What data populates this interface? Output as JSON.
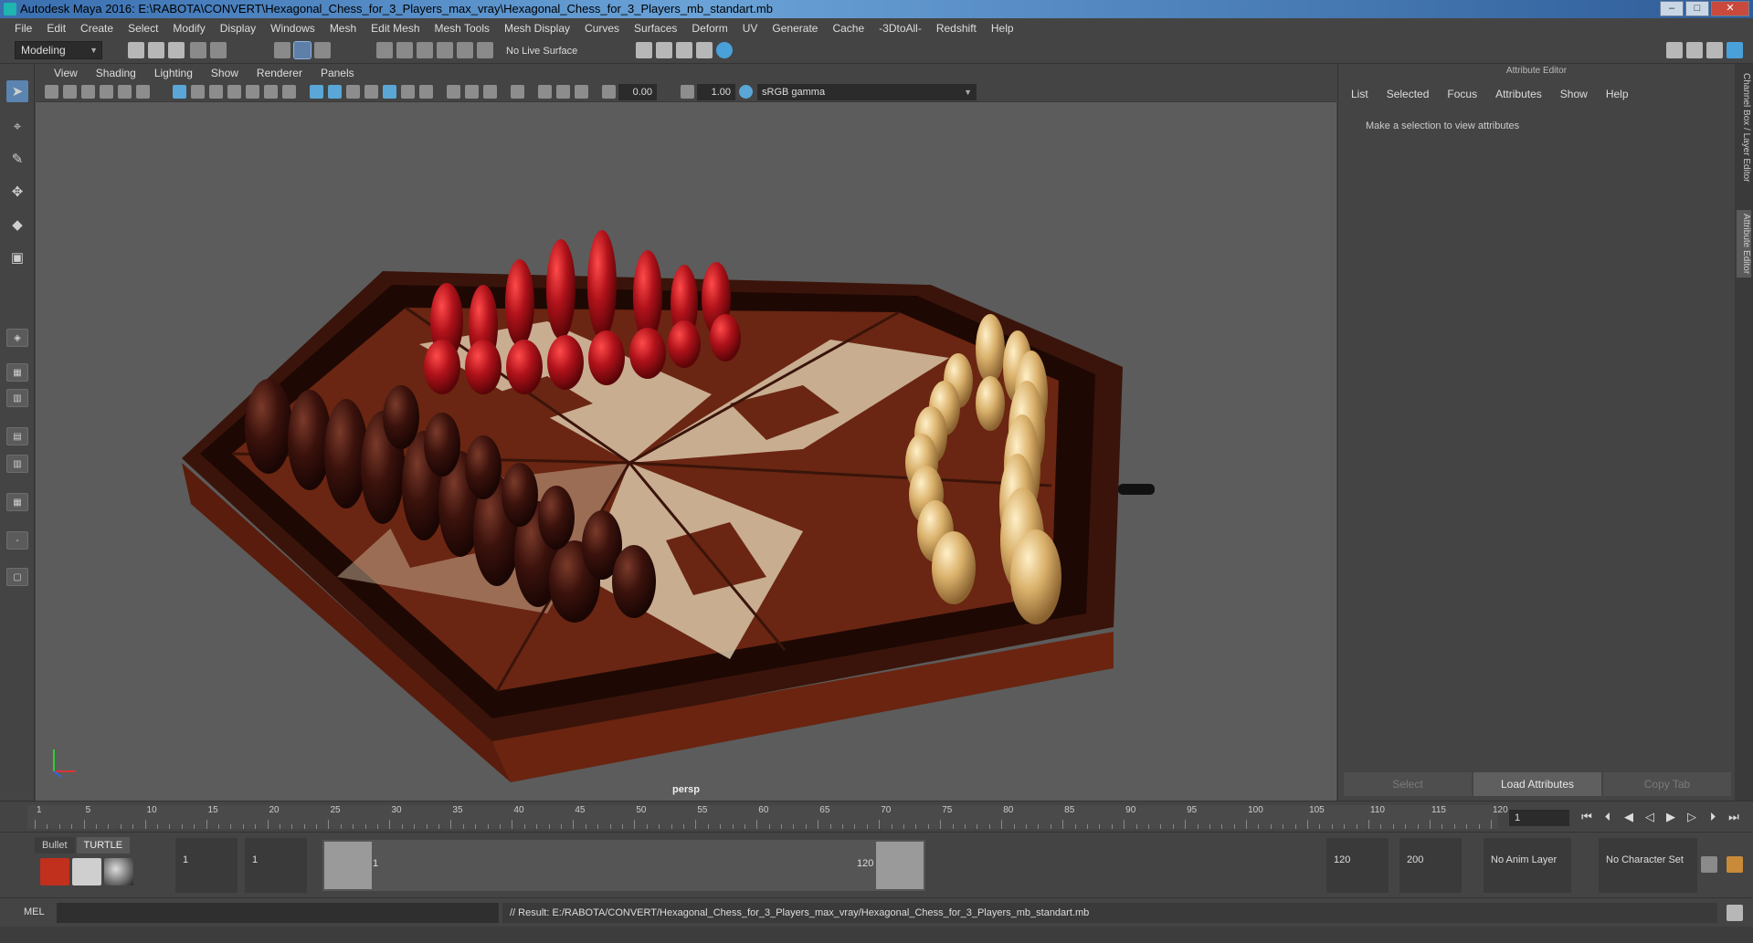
{
  "window": {
    "title": "Autodesk Maya 2016: E:\\RABOTA\\CONVERT\\Hexagonal_Chess_for_3_Players_max_vray\\Hexagonal_Chess_for_3_Players_mb_standart.mb",
    "min": "–",
    "max": "□",
    "close": "✕"
  },
  "menus": [
    "File",
    "Edit",
    "Create",
    "Select",
    "Modify",
    "Display",
    "Windows",
    "Mesh",
    "Edit Mesh",
    "Mesh Tools",
    "Mesh Display",
    "Curves",
    "Surfaces",
    "Deform",
    "UV",
    "Generate",
    "Cache",
    "-3DtoAll-",
    "Redshift",
    "Help"
  ],
  "shelf": {
    "mode": "Modeling",
    "live_surface": "No Live Surface"
  },
  "viewport": {
    "menus": [
      "View",
      "Shading",
      "Lighting",
      "Show",
      "Renderer",
      "Panels"
    ],
    "exposure": "0.00",
    "gamma": "1.00",
    "color_space": "sRGB gamma",
    "camera": "persp"
  },
  "attribute_editor": {
    "title": "Attribute Editor",
    "menus": [
      "List",
      "Selected",
      "Focus",
      "Attributes",
      "Show",
      "Help"
    ],
    "message": "Make a selection to view attributes",
    "buttons": {
      "select": "Select",
      "load": "Load Attributes",
      "copy": "Copy Tab"
    }
  },
  "side_tabs": {
    "channel_box": "Channel Box / Layer Editor",
    "attribute_editor": "Attribute Editor"
  },
  "timeline": {
    "ticks": [
      "1",
      "5",
      "10",
      "15",
      "20",
      "25",
      "30",
      "35",
      "40",
      "45",
      "50",
      "55",
      "60",
      "65",
      "70",
      "75",
      "80",
      "85",
      "90",
      "95",
      "100",
      "105",
      "110",
      "115",
      "120"
    ],
    "current_frame": "1"
  },
  "range": {
    "shelf_tabs": [
      "Bullet",
      "TURTLE"
    ],
    "start": "1",
    "playback_start": "1",
    "slider_start": "1",
    "slider_end": "120",
    "playback_end": "120",
    "end": "200",
    "anim_layer": "No Anim Layer",
    "character_set": "No Character Set"
  },
  "command": {
    "label": "MEL",
    "result": "// Result: E:/RABOTA/CONVERT/Hexagonal_Chess_for_3_Players_max_vray/Hexagonal_Chess_for_3_Players_mb_standart.mb"
  },
  "colors": {
    "accent": "#5b84b0",
    "maya_teal": "#1fb5b0",
    "red_pieces": "#b0121a",
    "dark_pieces": "#3b120c",
    "light_pieces": "#d9b06a",
    "board_dark": "#6a2612",
    "board_light": "#d9c6a8"
  }
}
